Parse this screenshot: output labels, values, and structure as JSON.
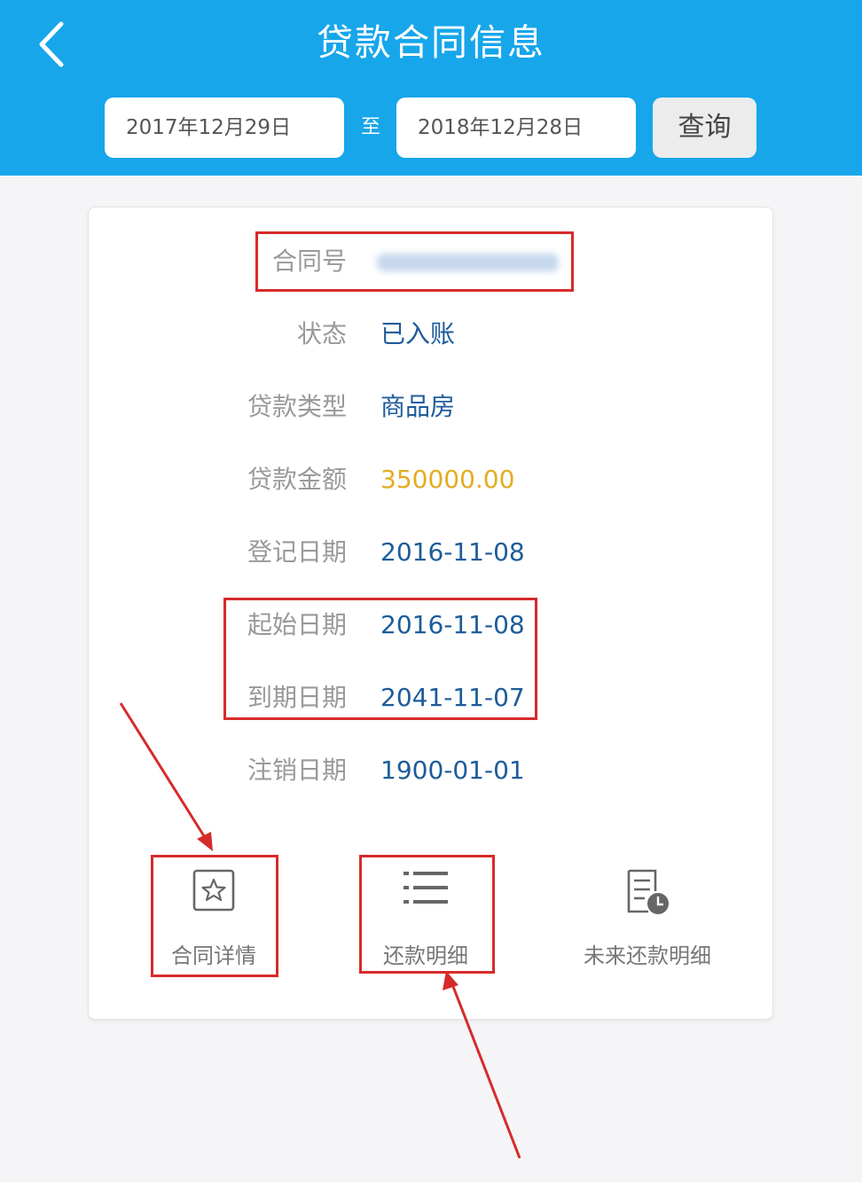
{
  "header": {
    "title": "贷款合同信息",
    "back_icon": "chevron-left-icon",
    "date_from": "2017年12月29日",
    "to_label": "至",
    "date_to": "2018年12月28日",
    "query_label": "查询"
  },
  "card": {
    "contract_no_label": "合同号",
    "fields": [
      {
        "label": "状态",
        "value": "已入账"
      },
      {
        "label": "贷款类型",
        "value": "商品房"
      },
      {
        "label": "贷款金额",
        "value": "350000.00"
      },
      {
        "label": "登记日期",
        "value": "2016-11-08"
      },
      {
        "label": "起始日期",
        "value": "2016-11-08"
      },
      {
        "label": "到期日期",
        "value": "2041-11-07"
      },
      {
        "label": "注销日期",
        "value": "1900-01-01"
      }
    ],
    "actions": [
      {
        "label": "合同详情",
        "icon": "star-document-icon"
      },
      {
        "label": "还款明细",
        "icon": "list-icon"
      },
      {
        "label": "未来还款明细",
        "icon": "schedule-document-icon"
      }
    ]
  },
  "colors": {
    "header_bg": "#17a6ea",
    "value_text": "#1d5c9a",
    "amount_text": "#e2ad22",
    "highlight_red": "#d62b2b"
  }
}
